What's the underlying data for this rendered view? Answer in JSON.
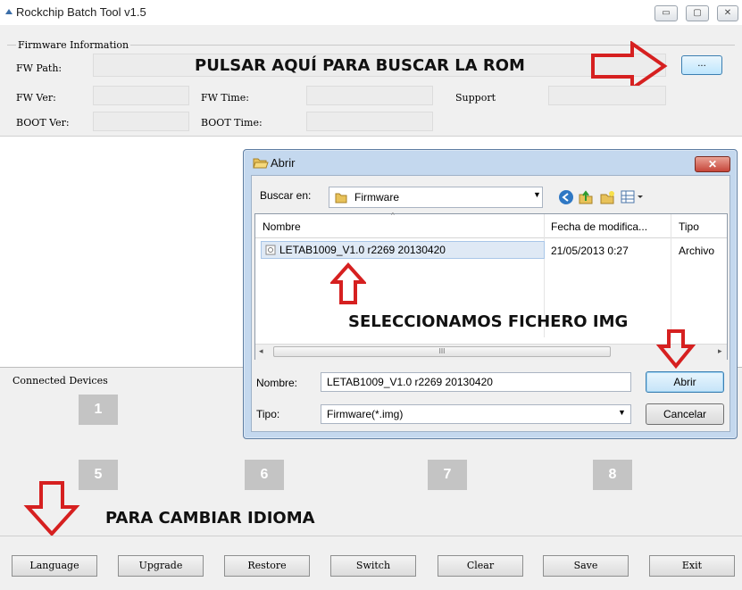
{
  "window": {
    "title": "Rockchip Batch Tool v1.5",
    "controls": {
      "minimize": "▭",
      "maximize": "▢",
      "close": "✕"
    }
  },
  "firmware_info": {
    "legend": "Firmware Information",
    "fw_path_label": "FW Path:",
    "fw_path_value": "",
    "fw_ver_label": "FW Ver:",
    "fw_time_label": "FW Time:",
    "support_label": "Support",
    "boot_ver_label": "BOOT Ver:",
    "boot_time_label": "BOOT Time:",
    "browse_label": "..."
  },
  "annotations": {
    "browse_rom": "PULSAR AQUÍ PARA BUSCAR LA ROM",
    "select_img": "SELECCIONAMOS FICHERO IMG",
    "change_language": "PARA CAMBIAR IDIOMA"
  },
  "devices": {
    "label": "Connected Devices",
    "slots": [
      "1",
      "5",
      "6",
      "7",
      "8"
    ]
  },
  "bottom_buttons": {
    "language": "Language",
    "upgrade": "Upgrade",
    "restore": "Restore",
    "switch": "Switch",
    "clear": "Clear",
    "save": "Save",
    "exit": "Exit"
  },
  "open_dialog": {
    "title": "Abrir",
    "close": "✕",
    "look_in_label": "Buscar en:",
    "look_in_value": "Firmware",
    "columns": {
      "name": "Nombre",
      "modified": "Fecha de modifica...",
      "type": "Tipo"
    },
    "files": [
      {
        "name": "LETAB1009_V1.0 r2269 20130420",
        "modified": "21/05/2013 0:27",
        "type": "Archivo"
      }
    ],
    "scroll_grip": "III",
    "filename_label": "Nombre:",
    "filename_value": "LETAB1009_V1.0 r2269 20130420",
    "filetype_label": "Tipo:",
    "filetype_value": "Firmware(*.img)",
    "open_button": "Abrir",
    "cancel_button": "Cancelar"
  },
  "colors": {
    "arrow": "#d62020",
    "dialog_frame": "#c4d8ee",
    "selected_row": "#dfe9f5"
  }
}
